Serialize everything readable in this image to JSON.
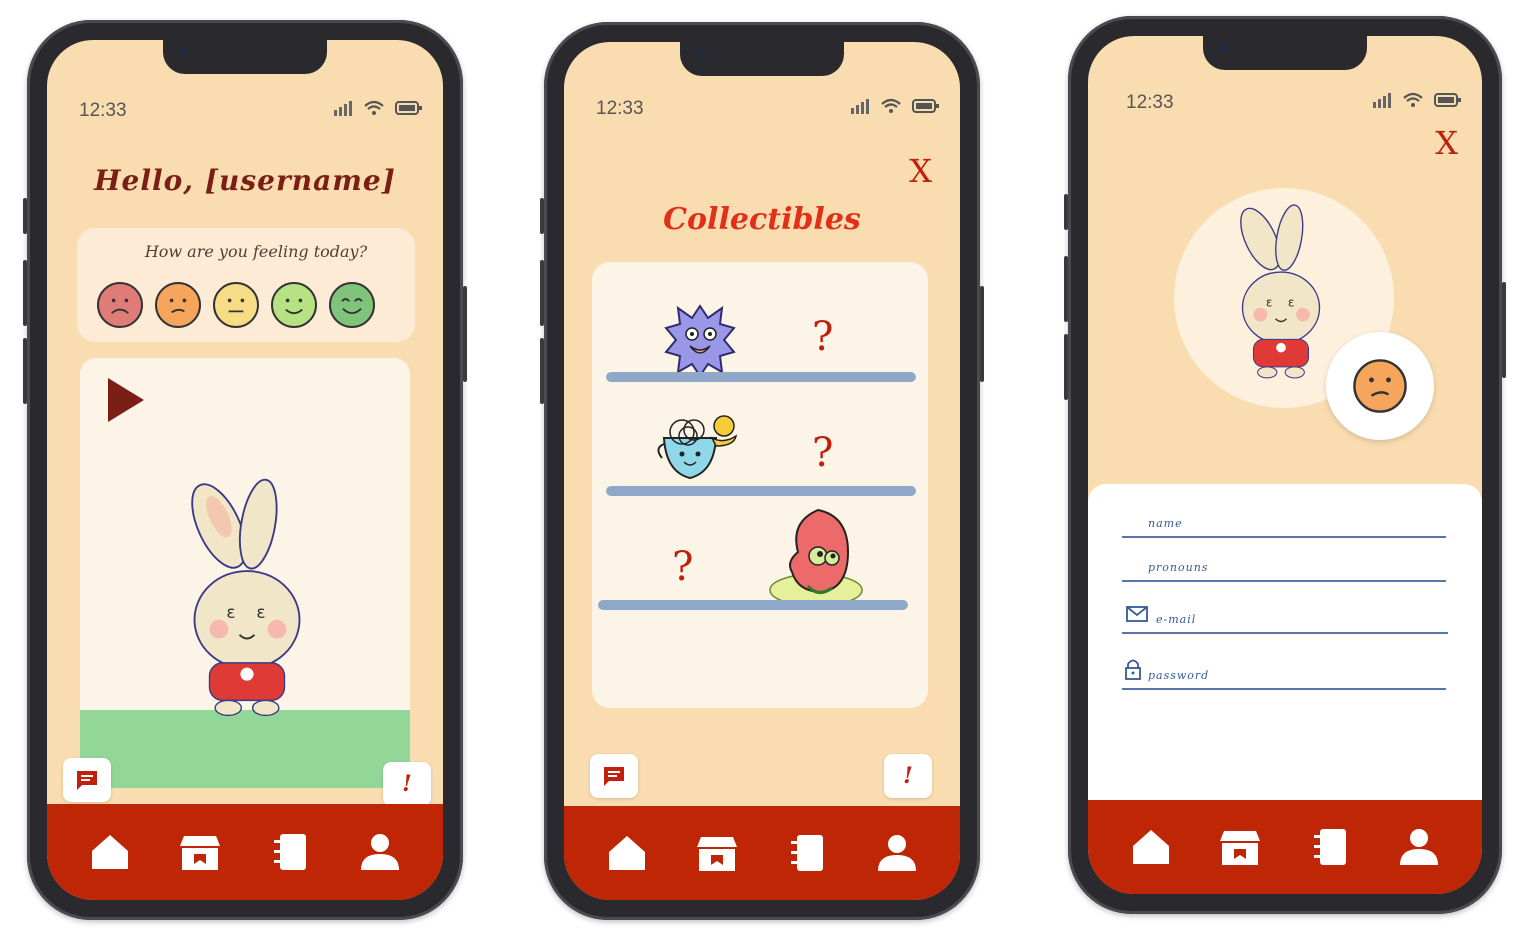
{
  "colors": {
    "bg": "#f9dcb0",
    "tabbar": "#bf2605",
    "accent": "#c0200c",
    "panel": "#fdf4e8"
  },
  "status": {
    "time": "12:33"
  },
  "home": {
    "greeting": "Hello, [username]",
    "mood_question": "How are you feeling today?",
    "moods": [
      {
        "name": "very-sad",
        "color": "#e07c78"
      },
      {
        "name": "sad",
        "color": "#f5a55c"
      },
      {
        "name": "neutral",
        "color": "#f6dc84"
      },
      {
        "name": "happy",
        "color": "#b6e282"
      },
      {
        "name": "very-happy",
        "color": "#7fc47a"
      }
    ]
  },
  "collectibles": {
    "close_label": "X",
    "title": "Collectibles",
    "shelves": [
      {
        "left": "spiky-monster",
        "right": "?"
      },
      {
        "left": "teacup-creature",
        "right": "?"
      },
      {
        "left": "?",
        "right": "strawberry-creature"
      }
    ]
  },
  "profile": {
    "close_label": "X",
    "fields": [
      {
        "label": "name",
        "icon": ""
      },
      {
        "label": "pronouns",
        "icon": ""
      },
      {
        "label": "e-mail",
        "icon": "mail-icon"
      },
      {
        "label": "password",
        "icon": "lock-icon"
      }
    ]
  },
  "floating": {
    "exclaim": "!"
  },
  "tabs": [
    "home-icon",
    "shop-icon",
    "journal-icon",
    "profile-icon"
  ]
}
